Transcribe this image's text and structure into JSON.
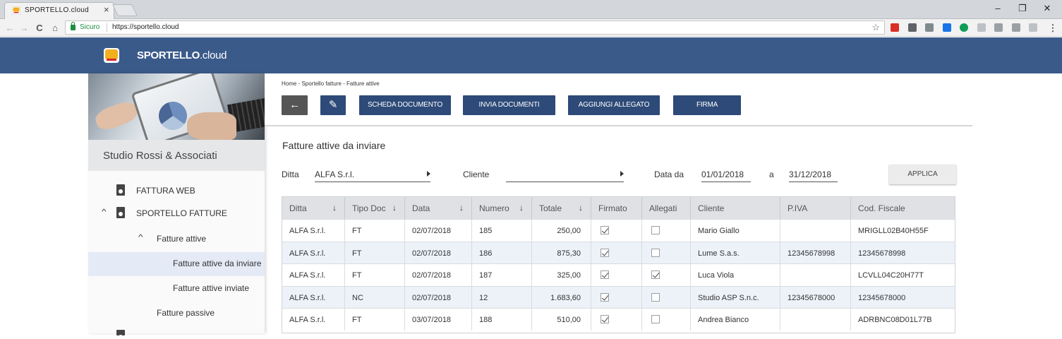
{
  "browser": {
    "tab_title": "SPORTELLO.cloud",
    "tab_close": "×",
    "secure_label": "Sicuro",
    "url": "https://sportello.cloud",
    "win_minimize": "–",
    "win_restore": "❐",
    "win_close": "✕",
    "nav_back": "←",
    "nav_forward": "→",
    "nav_reload": "C",
    "nav_home": "⌂",
    "bookmark": "☆",
    "menu": "⋮",
    "extension_colors": [
      "#d93025",
      "#5f6368",
      "#7f8c8d",
      "#1a73e8",
      "#0f9d58",
      "#bdc1c6",
      "#9aa0a6",
      "#9aa0a6",
      "#bdc1c6"
    ]
  },
  "header": {
    "brand_bold": "SPORTELLO",
    "brand_light": ".cloud",
    "color": "#3a5a8a"
  },
  "sidebar": {
    "studio_name": "Studio Rossi & Associati",
    "items": [
      {
        "label": "FATTURA WEB",
        "icon": "document-web-icon"
      },
      {
        "label": "SPORTELLO FATTURE",
        "icon": "document-person-icon",
        "chevron": "^"
      },
      {
        "label": "Fatture attive",
        "chevron": "^"
      },
      {
        "label": "Fatture attive da inviare",
        "active": true
      },
      {
        "label": "Fatture attive inviate"
      },
      {
        "label": "Fatture passive"
      }
    ]
  },
  "toolbar": {
    "breadcrumb": "Home - Sportello fatture - Fatture attive",
    "back_icon": "←",
    "edit_icon": "✎",
    "buttons": [
      "SCHEDA DOCUMENTO",
      "INVIA DOCUMENTI",
      "AGGIUNGI ALLEGATO",
      "FIRMA"
    ],
    "button_color": "#2d4a78"
  },
  "page_title": "Fatture attive da inviare",
  "filters": {
    "ditta_label": "Ditta",
    "ditta_value": "ALFA S.r.l.",
    "cliente_label": "Cliente",
    "cliente_value": "",
    "data_da_label": "Data da",
    "data_da_value": "01/01/2018",
    "a_label": "a",
    "data_a_value": "31/12/2018",
    "apply_label": "APPLICA"
  },
  "table": {
    "sort_icon": "↓",
    "columns": [
      "Ditta",
      "Tipo Doc",
      "Data",
      "Numero",
      "Totale",
      "Firmato",
      "Allegati",
      "Cliente",
      "P.IVA",
      "Cod. Fiscale"
    ],
    "rows": [
      {
        "ditta": "ALFA S.r.l.",
        "tipo": "FT",
        "data": "02/07/2018",
        "numero": "185",
        "totale": "250,00",
        "firmato": true,
        "allegati": false,
        "cliente": "Mario Giallo",
        "piva": "",
        "cf": "MRIGLL02B40H55F"
      },
      {
        "ditta": "ALFA S.r.l.",
        "tipo": "FT",
        "data": "02/07/2018",
        "numero": "186",
        "totale": "875,30",
        "firmato": true,
        "allegati": false,
        "cliente": "Lume S.a.s.",
        "piva": "12345678998",
        "cf": "12345678998"
      },
      {
        "ditta": "ALFA S.r.l.",
        "tipo": "FT",
        "data": "02/07/2018",
        "numero": "187",
        "totale": "325,00",
        "firmato": true,
        "allegati": true,
        "cliente": "Luca Viola",
        "piva": "",
        "cf": "LCVLL04C20H77T"
      },
      {
        "ditta": "ALFA S.r.l.",
        "tipo": "NC",
        "data": "02/07/2018",
        "numero": "12",
        "totale": "1.683,60",
        "firmato": true,
        "allegati": false,
        "cliente": "Studio ASP S.n.c.",
        "piva": "12345678000",
        "cf": "12345678000"
      },
      {
        "ditta": "ALFA S.r.l.",
        "tipo": "FT",
        "data": "03/07/2018",
        "numero": "188",
        "totale": "510,00",
        "firmato": true,
        "allegati": false,
        "cliente": "Andrea Bianco",
        "piva": "",
        "cf": "ADRBNC08D01L77B"
      }
    ]
  }
}
